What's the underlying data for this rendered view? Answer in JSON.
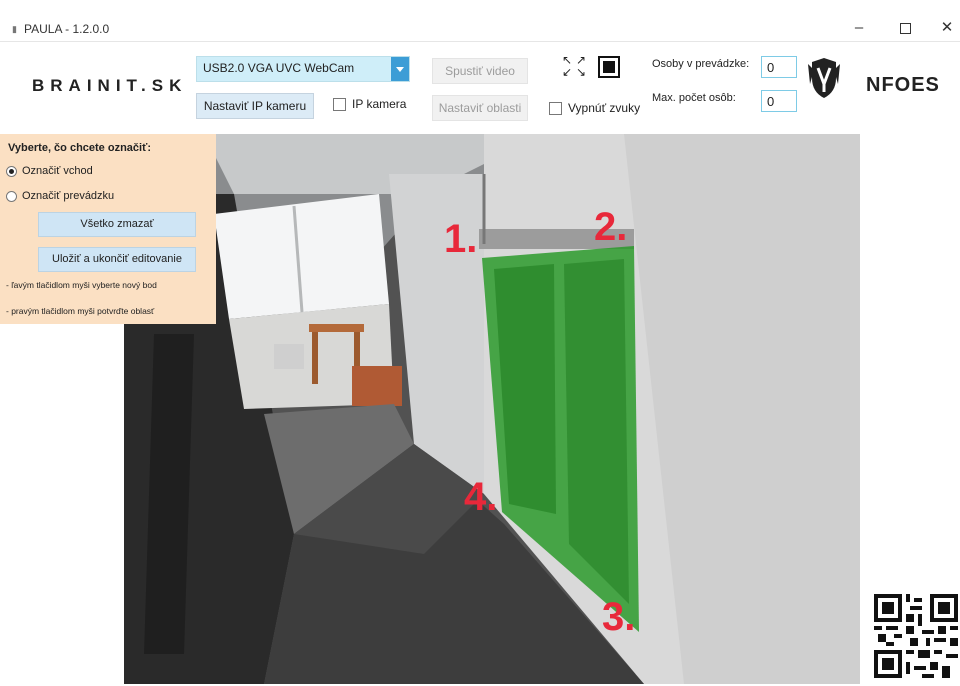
{
  "window": {
    "app_icon": "▮",
    "title": "PAULA - 1.2.0.0",
    "minimize": "–",
    "close": "✕"
  },
  "toolbar": {
    "brand": "BRAINIT.SK",
    "camera_select": "USB2.0 VGA UVC WebCam",
    "set_ip_camera": "Nastaviť IP kameru",
    "ip_camera_checkbox": "IP kamera",
    "start_video": "Spustiť video",
    "set_areas": "Nastaviť oblasti",
    "mute_sounds": "Vypnúť zvuky",
    "persons_label": "Osoby v prevádzke:",
    "persons_value": "0",
    "max_label": "Max. počet osôb:",
    "max_value": "0",
    "partner_logo": "NFOES"
  },
  "edit_panel": {
    "title": "Vyberte, čo chcete označiť:",
    "option_entry": "Označiť vchod",
    "option_premise": "Označiť prevádzku",
    "selected": "Označiť vchod",
    "clear_all": "Všetko zmazať",
    "save_finish": "Uložiť a ukončiť editovanie",
    "hint_left": "- ľavým tlačidlom myši vyberte nový bod",
    "hint_right": "- pravým tlačidlom myši potvrďte oblasť"
  },
  "camera": {
    "markers": [
      "1.",
      "2.",
      "3.",
      "4."
    ],
    "area_color": "#2c9a2c",
    "marker_color": "#e8283a"
  },
  "icons": {
    "expand": "expand-icon",
    "fullscreen": "fullscreen-icon",
    "partner": "shield-logo-icon",
    "qr": "qr-code-icon"
  }
}
